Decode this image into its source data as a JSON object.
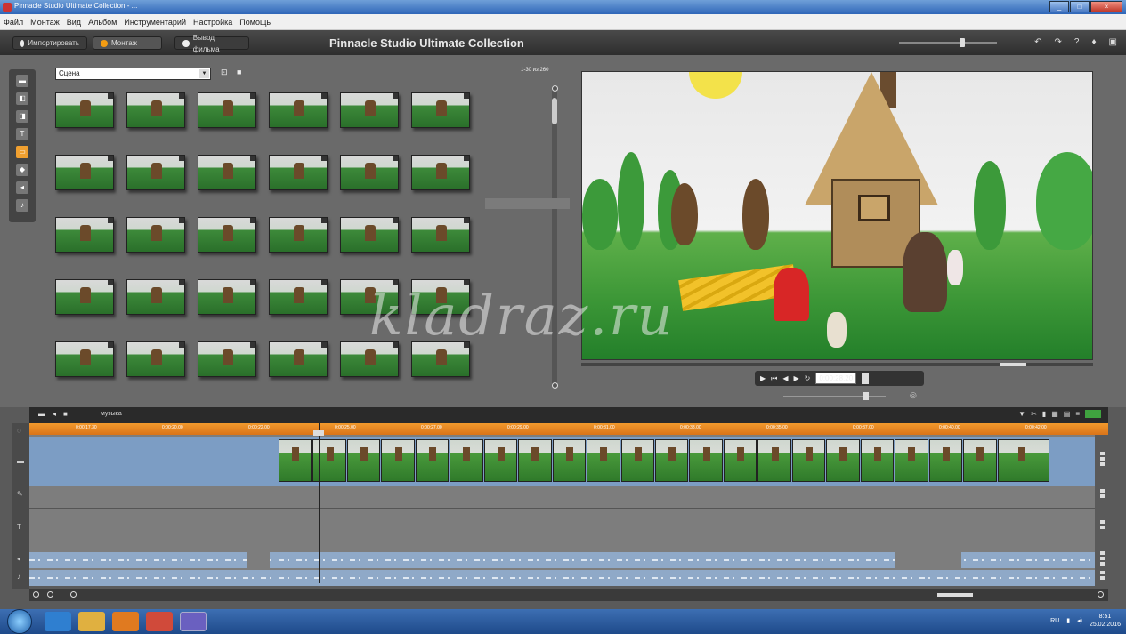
{
  "window": {
    "title": "Pinnacle Studio Ultimate Collection - ...",
    "controls": [
      "_",
      "□",
      "×"
    ]
  },
  "menu": [
    "Файл",
    "Монтаж",
    "Вид",
    "Альбом",
    "Инструментарий",
    "Настройка",
    "Помощь"
  ],
  "modules": [
    {
      "label": "Импортировать",
      "active": false
    },
    {
      "label": "Монтаж",
      "active": true
    },
    {
      "label": "Вывод фильма",
      "active": false
    }
  ],
  "app_title": "Pinnacle Studio Ultimate Collection",
  "album": {
    "folder": "Сцена",
    "counter": "1-30 из 260",
    "thumb_count": 30,
    "sidebar_icons": [
      "video-icon",
      "photo-icon",
      "transition-icon",
      "title-icon",
      "menu-icon",
      "effect-icon",
      "sound-icon",
      "music-icon"
    ]
  },
  "preview": {
    "watermark": "kladraz.ru",
    "timecode": "0:00:28.20"
  },
  "timeline": {
    "header_label": "музыка",
    "ruler_ticks": [
      "0:00:17.30",
      "0:00:20.00",
      "0:00:22.00",
      "0:00:25.00",
      "0:00:27.00",
      "0:00:29.00",
      "0:00:31.00",
      "0:00:33.00",
      "0:00:35.00",
      "0:00:37.00",
      "0:00:40.00",
      "0:00:42.00"
    ],
    "clip_count": 22,
    "tracks": [
      "video",
      "overlay",
      "title",
      "sound",
      "music"
    ]
  },
  "taskbar": {
    "language": "RU",
    "time": "8:51",
    "date": "25.02.2016"
  },
  "colors": {
    "ruler": "#e8881f",
    "active_module": "#f39c12",
    "video_track": "#7c9dc4",
    "audio_track": "#8fa9c8"
  }
}
